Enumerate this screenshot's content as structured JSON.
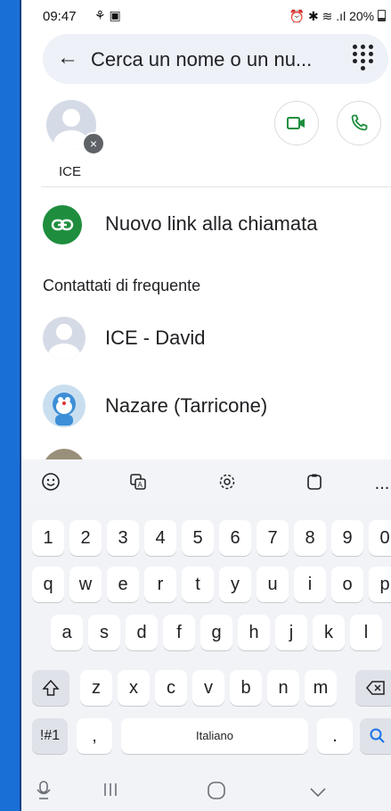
{
  "status": {
    "time": "09:47",
    "left_icons": "⚘ ▣",
    "right_icons": "⏰ ✱ ≋ .ıl",
    "battery": "20%"
  },
  "search": {
    "placeholder": "Cerca un nome o un nu..."
  },
  "top_contact": {
    "name": "ICE"
  },
  "new_link": {
    "label": "Nuovo link alla chiamata"
  },
  "frequent": {
    "title": "Contattati di frequente",
    "items": [
      {
        "name": "ICE - David"
      },
      {
        "name": "Nazare (Tarricone)"
      }
    ]
  },
  "keyboard": {
    "toolbar_more": "...",
    "number_row": [
      "1",
      "2",
      "3",
      "4",
      "5",
      "6",
      "7",
      "8",
      "9",
      "0"
    ],
    "row1": [
      "q",
      "w",
      "e",
      "r",
      "t",
      "y",
      "u",
      "i",
      "o",
      "p"
    ],
    "row2": [
      "a",
      "s",
      "d",
      "f",
      "g",
      "h",
      "j",
      "k",
      "l"
    ],
    "row3": [
      "z",
      "x",
      "c",
      "v",
      "b",
      "n",
      "m"
    ],
    "symbols_key": "!#1",
    "comma_key": ",",
    "space_label": "Italiano",
    "period_key": "."
  },
  "colors": {
    "accent_green": "#1e8e3e",
    "frame_blue": "#1a6fd6"
  }
}
